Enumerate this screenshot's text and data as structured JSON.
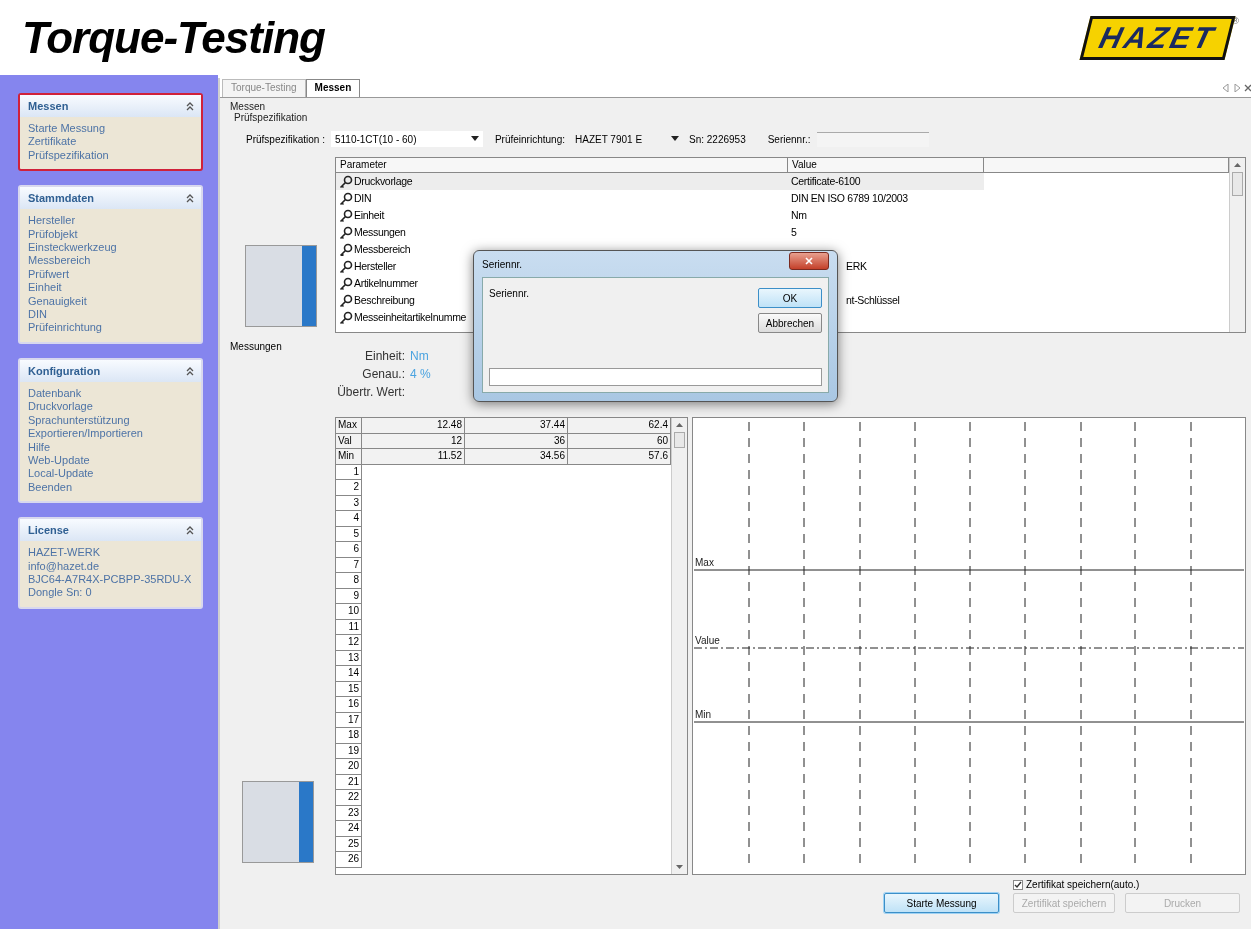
{
  "header": {
    "title": "Torque-Testing",
    "logo": "HAZET",
    "registered_mark": "®"
  },
  "sidebar": {
    "panels": [
      {
        "title": "Messen",
        "selected": true,
        "items": [
          "Starte Messung",
          "Zertifikate",
          "Prüfspezifikation"
        ]
      },
      {
        "title": "Stammdaten",
        "selected": false,
        "items": [
          "Hersteller",
          "Prüfobjekt",
          "Einsteckwerkzeug",
          "Messbereich",
          "Prüfwert",
          "Einheit",
          "Genauigkeit",
          "DIN",
          "Prüfeinrichtung"
        ]
      },
      {
        "title": "Konfiguration",
        "selected": false,
        "items": [
          "Datenbank",
          "Druckvorlage",
          "Sprachunterstützung",
          "Exportieren/Importieren",
          "Hilfe",
          "Web-Update",
          "Local-Update",
          "Beenden"
        ]
      },
      {
        "title": "License",
        "selected": false,
        "items": [
          "HAZET-WERK",
          "info@hazet.de",
          "BJC64-A7R4X-PCBPP-35RDU-X",
          "Dongle Sn: 0"
        ]
      }
    ]
  },
  "tabs": [
    {
      "label": "Torque-Testing",
      "selected": false
    },
    {
      "label": "Messen",
      "selected": true
    }
  ],
  "page": {
    "title": "Messen",
    "group": "Prüfspezifikation"
  },
  "spec_fields": {
    "spec_label": "Prüfspezifikation :",
    "spec_value": "5110-1CT(10 - 60)",
    "device_label": "Prüfeinrichtung:",
    "device_value": "HAZET 7901 E",
    "serial_number": "Sn: 2226953",
    "serial_label": "Seriennr.:"
  },
  "parameters": {
    "columns": [
      "Parameter",
      "Value"
    ],
    "rows": [
      {
        "name": "Druckvorlage",
        "value": "Certificate-6100",
        "selected": true,
        "covered": false
      },
      {
        "name": "DIN",
        "value": "DIN EN ISO 6789 10/2003",
        "selected": false,
        "covered": false
      },
      {
        "name": "Einheit",
        "value": "Nm",
        "selected": false,
        "covered": false
      },
      {
        "name": "Messungen",
        "value": "5",
        "selected": false,
        "covered": false
      },
      {
        "name": "Messbereich",
        "selected": false
      },
      {
        "name": "Hersteller",
        "value": "ERK",
        "selected": false,
        "covered": true
      },
      {
        "name": "Artikelnummer",
        "selected": false
      },
      {
        "name": "Beschreibung",
        "value": "nt-Schlüssel",
        "selected": false,
        "covered": true
      },
      {
        "name": "Messeinheitartikelnumme",
        "selected": false
      }
    ]
  },
  "measurements": {
    "title": "Messungen",
    "unit_label": "Einheit:",
    "unit": "Nm",
    "accuracy_label": "Genau.:",
    "accuracy": "4 %",
    "transfer_label": "Übertr. Wert:",
    "limit_rows": [
      {
        "label": "Max",
        "values": [
          "12.48",
          "37.44",
          "62.4"
        ]
      },
      {
        "label": "Val",
        "values": [
          "12",
          "36",
          "60"
        ]
      },
      {
        "label": "Min",
        "values": [
          "11.52",
          "34.56",
          "57.6"
        ]
      }
    ],
    "row_numbers": [
      "1",
      "2",
      "3",
      "4",
      "5",
      "6",
      "7",
      "8",
      "9",
      "10",
      "11",
      "12",
      "13",
      "14",
      "15",
      "16",
      "17",
      "18",
      "19",
      "20",
      "21",
      "22",
      "23",
      "24",
      "25",
      "26"
    ]
  },
  "chart": {
    "labels": [
      "Max",
      "Value",
      "Min"
    ]
  },
  "footer": {
    "auto_save": {
      "label": "Zertifikat speichern(auto.)",
      "checked": true
    },
    "buttons": [
      {
        "label": "Starte Messung",
        "disabled": false,
        "default": true
      },
      {
        "label": "Zertifikat speichern",
        "disabled": true,
        "default": false
      },
      {
        "label": "Drucken",
        "disabled": true,
        "default": false
      }
    ]
  },
  "dialog": {
    "title": "Seriennr.",
    "prompt": "Seriennr.",
    "buttons": [
      {
        "label": "OK",
        "default": true
      },
      {
        "label": "Abbrechen",
        "default": false
      }
    ]
  }
}
